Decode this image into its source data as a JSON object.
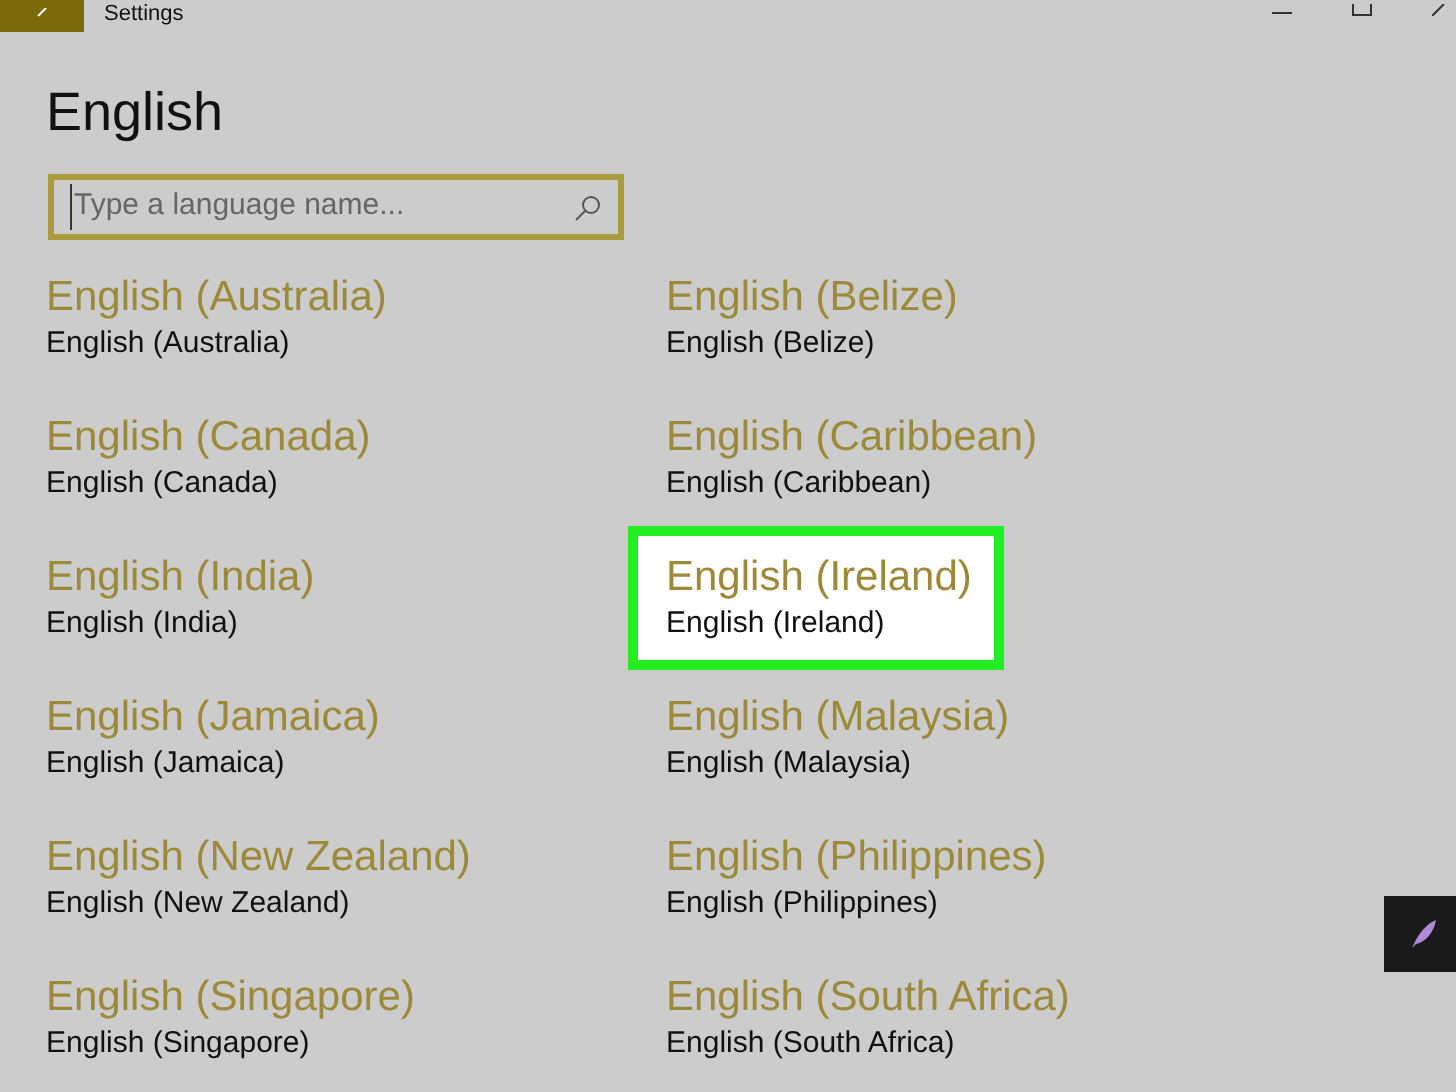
{
  "window": {
    "title": "Settings"
  },
  "page": {
    "title": "English"
  },
  "search": {
    "placeholder": "Type a language name..."
  },
  "languages": [
    {
      "name": "English (Australia)",
      "native": "English (Australia)",
      "selected": false
    },
    {
      "name": "English (Belize)",
      "native": "English (Belize)",
      "selected": false
    },
    {
      "name": "English (Canada)",
      "native": "English (Canada)",
      "selected": false
    },
    {
      "name": "English (Caribbean)",
      "native": "English (Caribbean)",
      "selected": false
    },
    {
      "name": "English (India)",
      "native": "English (India)",
      "selected": false
    },
    {
      "name": "English (Ireland)",
      "native": "English (Ireland)",
      "selected": true
    },
    {
      "name": "English (Jamaica)",
      "native": "English (Jamaica)",
      "selected": false
    },
    {
      "name": "English (Malaysia)",
      "native": "English (Malaysia)",
      "selected": false
    },
    {
      "name": "English (New Zealand)",
      "native": "English (New Zealand)",
      "selected": false
    },
    {
      "name": "English (Philippines)",
      "native": "English (Philippines)",
      "selected": false
    },
    {
      "name": "English (Singapore)",
      "native": "English (Singapore)",
      "selected": false
    },
    {
      "name": "English (South Africa)",
      "native": "English (South Africa)",
      "selected": false
    }
  ]
}
